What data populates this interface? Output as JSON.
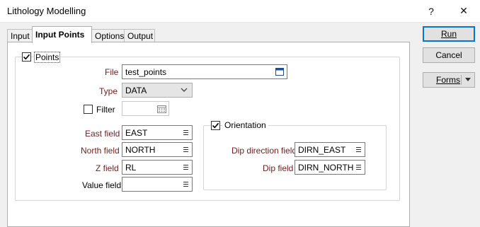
{
  "window": {
    "title": "Lithology Modelling",
    "help_label": "?",
    "close_label": "✕"
  },
  "tabs": [
    {
      "label": "Input"
    },
    {
      "label": "Input Points"
    },
    {
      "label": "Options"
    },
    {
      "label": "Output"
    }
  ],
  "points": {
    "label": "Points",
    "checked": true,
    "file_label": "File",
    "file_value": "test_points",
    "type_label": "Type",
    "type_value": "DATA",
    "filter_label": "Filter",
    "filter_checked": false,
    "filter_value": "",
    "east_label": "East field",
    "east_value": "EAST",
    "north_label": "North field",
    "north_value": "NORTH",
    "z_label": "Z field",
    "z_value": "RL",
    "value_label": "Value field",
    "value_value": ""
  },
  "orientation": {
    "label": "Orientation",
    "checked": true,
    "dipdir_label": "Dip direction field",
    "dipdir_value": "DIRN_EAST",
    "dip_label": "Dip field",
    "dip_value": "DIRN_NORTH"
  },
  "buttons": {
    "run_label": "Run",
    "cancel_label": "Cancel",
    "forms_label": "Forms"
  },
  "colors": {
    "accent": "#0078d7",
    "required_label": "#7b1a1a"
  }
}
